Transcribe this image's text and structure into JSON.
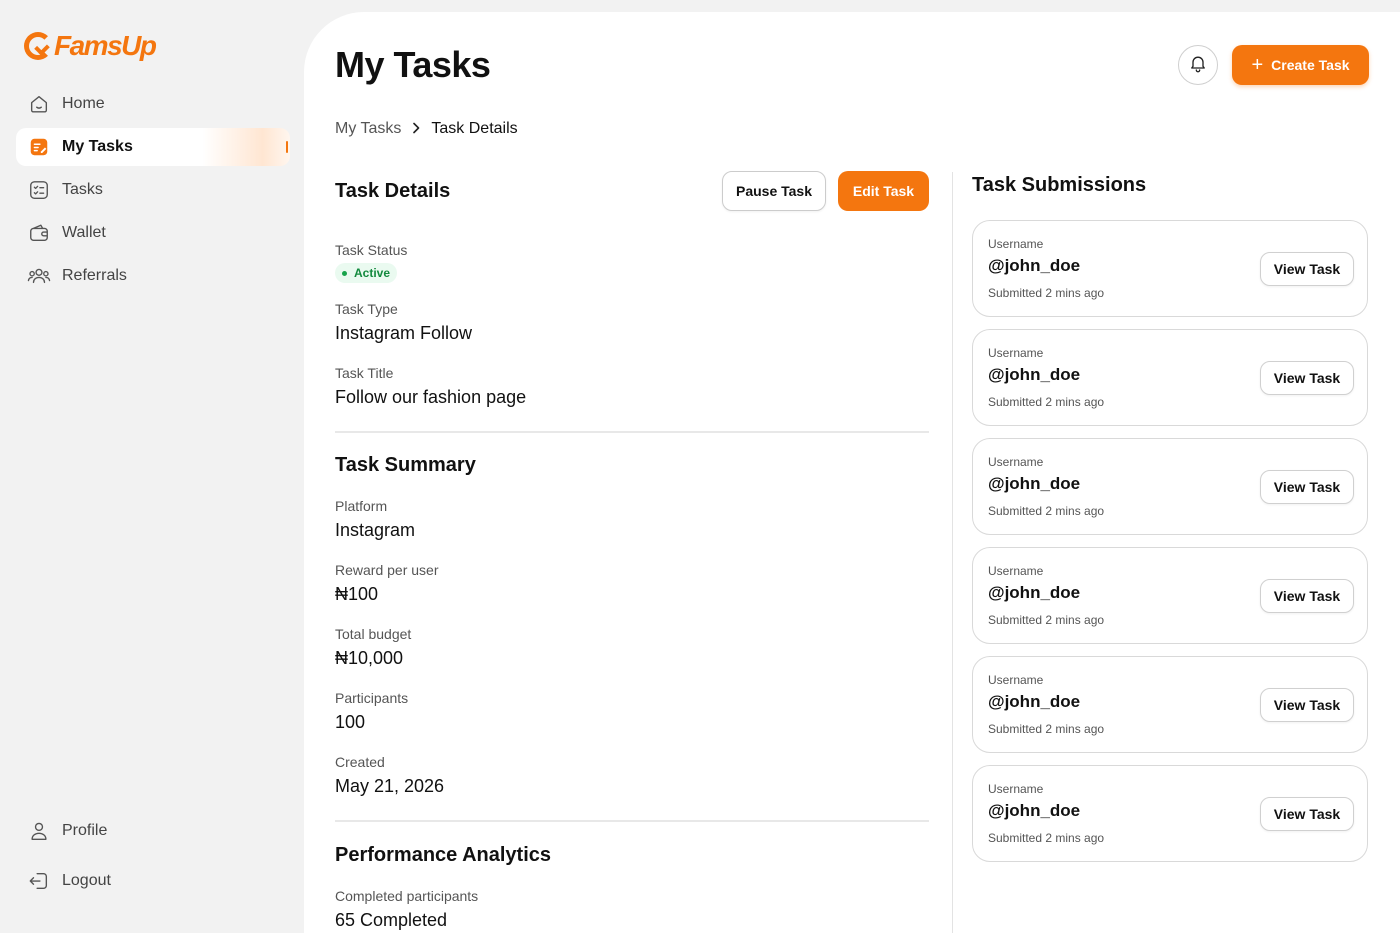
{
  "brand": {
    "logo_text": "FamsUp",
    "accent_color": "#f4760f"
  },
  "sidebar": {
    "items": [
      {
        "label": "Home",
        "icon": "home-icon"
      },
      {
        "label": "My Tasks",
        "icon": "edit-list-icon",
        "active": true
      },
      {
        "label": "Tasks",
        "icon": "checklist-icon"
      },
      {
        "label": "Wallet",
        "icon": "wallet-icon"
      },
      {
        "label": "Referrals",
        "icon": "users-icon"
      }
    ],
    "bottom_items": [
      {
        "label": "Profile",
        "icon": "user-icon"
      },
      {
        "label": "Logout",
        "icon": "logout-icon"
      }
    ]
  },
  "header": {
    "title": "My Tasks",
    "create_button": "Create Task",
    "bell_icon": "bell-icon"
  },
  "breadcrumb": {
    "parent": "My Tasks",
    "current": "Task Details"
  },
  "task_details": {
    "title": "Task Details",
    "pause_button": "Pause Task",
    "edit_button": "Edit Task",
    "status_label": "Task Status",
    "status_value": "Active",
    "type_label": "Task Type",
    "type_value": "Instagram Follow",
    "title_label": "Task Title",
    "title_value": "Follow our fashion page"
  },
  "task_summary": {
    "title": "Task Summary",
    "platform_label": "Platform",
    "platform_value": "Instagram",
    "reward_label": "Reward per user",
    "reward_value": "₦100",
    "budget_label": "Total budget",
    "budget_value": "₦10,000",
    "participants_label": "Participants",
    "participants_value": "100",
    "created_label": "Created",
    "created_value": "May 21, 2026"
  },
  "performance": {
    "title": "Performance Analytics",
    "completed_label": "Completed participants",
    "completed_value": "65 Completed"
  },
  "submissions": {
    "title": "Task Submissions",
    "items": [
      {
        "label": "Username",
        "username": "@john_doe",
        "time": "Submitted 2 mins ago",
        "button": "View Task"
      },
      {
        "label": "Username",
        "username": "@john_doe",
        "time": "Submitted 2 mins ago",
        "button": "View Task"
      },
      {
        "label": "Username",
        "username": "@john_doe",
        "time": "Submitted 2 mins ago",
        "button": "View Task"
      },
      {
        "label": "Username",
        "username": "@john_doe",
        "time": "Submitted 2 mins ago",
        "button": "View Task"
      },
      {
        "label": "Username",
        "username": "@john_doe",
        "time": "Submitted 2 mins ago",
        "button": "View Task"
      },
      {
        "label": "Username",
        "username": "@john_doe",
        "time": "Submitted 2 mins ago",
        "button": "View Task"
      }
    ]
  }
}
